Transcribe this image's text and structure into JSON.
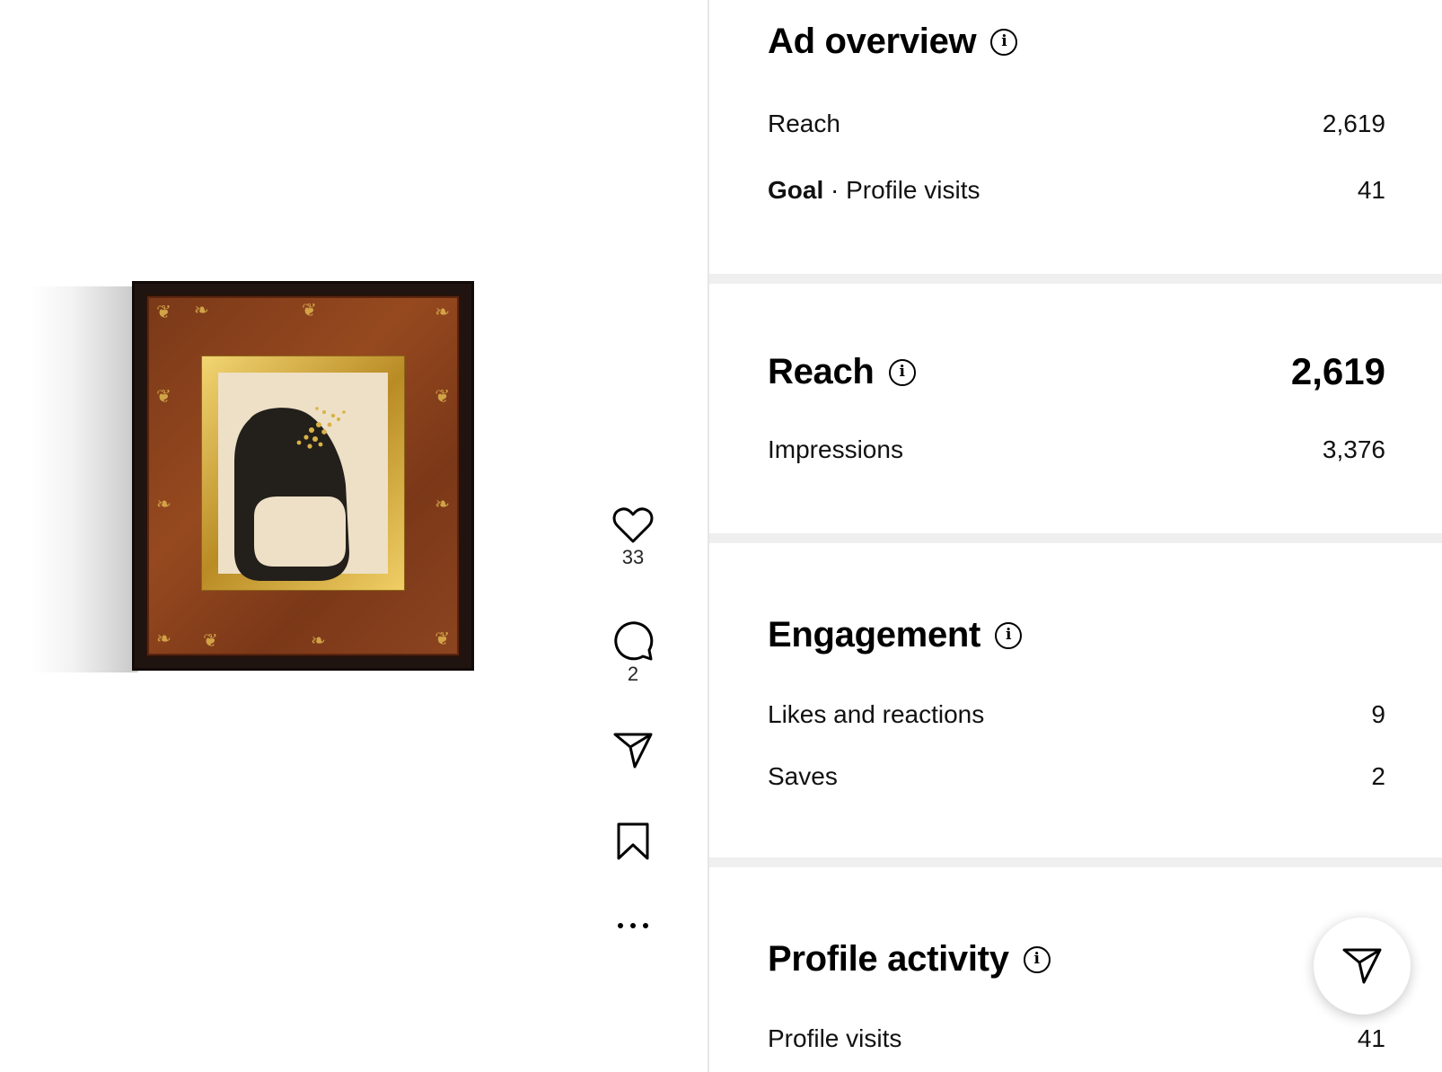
{
  "post": {
    "actions": {
      "like_count": "33",
      "comment_count": "2"
    }
  },
  "ad_overview": {
    "title": "Ad overview",
    "reach_label": "Reach",
    "reach_value": "2,619",
    "goal_label": "Goal",
    "goal_separator": "·",
    "goal_metric": "Profile visits",
    "goal_value": "41"
  },
  "reach": {
    "title": "Reach",
    "value": "2,619",
    "impressions_label": "Impressions",
    "impressions_value": "3,376"
  },
  "engagement": {
    "title": "Engagement",
    "likes_label": "Likes and reactions",
    "likes_value": "9",
    "saves_label": "Saves",
    "saves_value": "2"
  },
  "profile_activity": {
    "title": "Profile activity",
    "visits_label": "Profile visits",
    "visits_value": "41"
  },
  "icons": {
    "like": "heart-icon",
    "comment": "comment-icon",
    "share": "paper-plane-icon",
    "save": "bookmark-icon",
    "more": "more-icon",
    "info": "info-icon"
  },
  "colors": {
    "background": "#ffffff",
    "section_gap": "#efefef",
    "text": "#000000",
    "frame_wood": "#8c4420",
    "frame_gold": "#d6a94a"
  }
}
